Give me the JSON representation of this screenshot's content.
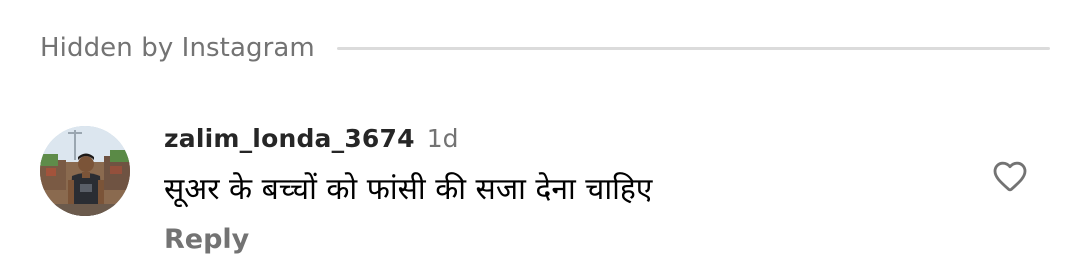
{
  "hidden_section": {
    "label": "Hidden by Instagram"
  },
  "comment": {
    "username": "zalim_londa_3674",
    "timestamp": "1d",
    "text": "सूअर के बच्चों को फांसी की सजा देना चाहिए",
    "reply_label": "Reply",
    "avatar_icon": "user-avatar-photo",
    "like_icon": "heart-outline-icon"
  },
  "colors": {
    "secondary_text": "#737373",
    "primary_text": "#262626",
    "divider": "#dbdbdb",
    "background": "#ffffff"
  }
}
